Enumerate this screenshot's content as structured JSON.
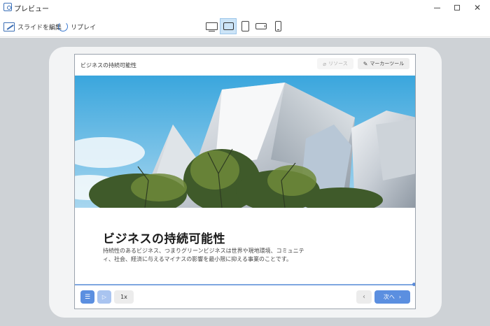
{
  "window": {
    "title": "プレビュー"
  },
  "toolbar": {
    "edit_label": "スライドを編集",
    "replay_label": "リプレイ",
    "devices": [
      "desktop",
      "tablet-landscape",
      "tablet-portrait",
      "phone-landscape",
      "phone-portrait"
    ],
    "selected_device": "tablet-landscape"
  },
  "slide": {
    "header_title": "ビジネスの持続可能性",
    "resource_label": "リソース",
    "marker_label": "マーカーツール",
    "title": "ビジネスの持続可能性",
    "body": "持続性のあるビジネス、つまりグリーンビジネスは世界や現地環境、コミュニティ、社会、経済に与えるマイナスの影響を最小限に抑える事業のことです。"
  },
  "player": {
    "speed_label": "1x",
    "next_label": "次へ",
    "prev_icon": "‹",
    "next_icon": "›"
  },
  "colors": {
    "accent": "#5b8fe0",
    "accent_light": "#a9c4f0",
    "stage": "#ced2d6",
    "selected_device_bg": "#cce4f7"
  }
}
